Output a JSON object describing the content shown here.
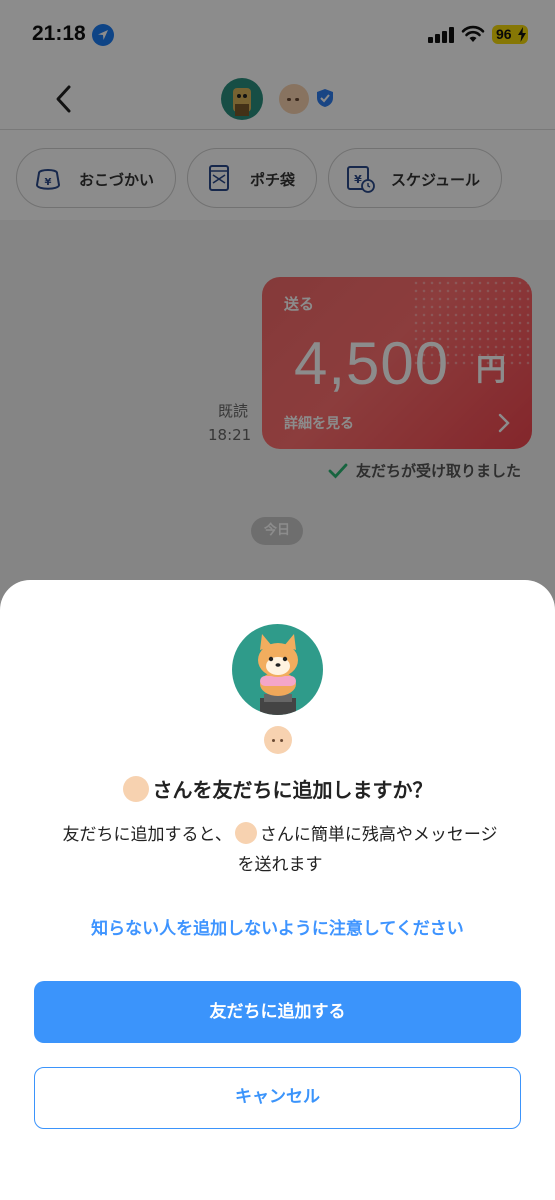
{
  "status_bar": {
    "time": "21:18",
    "battery": "96"
  },
  "chips": [
    {
      "label": "おこづかい",
      "icon": "wallet-yen-icon"
    },
    {
      "label": "ポチ袋",
      "icon": "envelope-gift-icon"
    },
    {
      "label": "スケジュール",
      "icon": "calendar-yen-icon"
    }
  ],
  "chat": {
    "read_label": "既読",
    "read_time": "18:21",
    "card": {
      "send_label": "送る",
      "amount": "4,500",
      "currency": "円",
      "details_label": "詳細を見る"
    },
    "received_text": "友だちが受け取りました",
    "date_badge": "今日"
  },
  "sheet": {
    "title": "さんを友だちに追加しますか？",
    "desc_line1_before": "友だちに追加すると、",
    "desc_line1_after": "さんに簡単に残高やメッセージ",
    "desc_line2": "を送れます",
    "caution": "知らない人を追加しないように注意してください",
    "add_button": "友だちに追加する",
    "cancel_button": "キャンセル"
  },
  "colors": {
    "accent": "#3b94fb",
    "card_red": "#f0464f",
    "avatar_teal": "#2f9b8a"
  }
}
